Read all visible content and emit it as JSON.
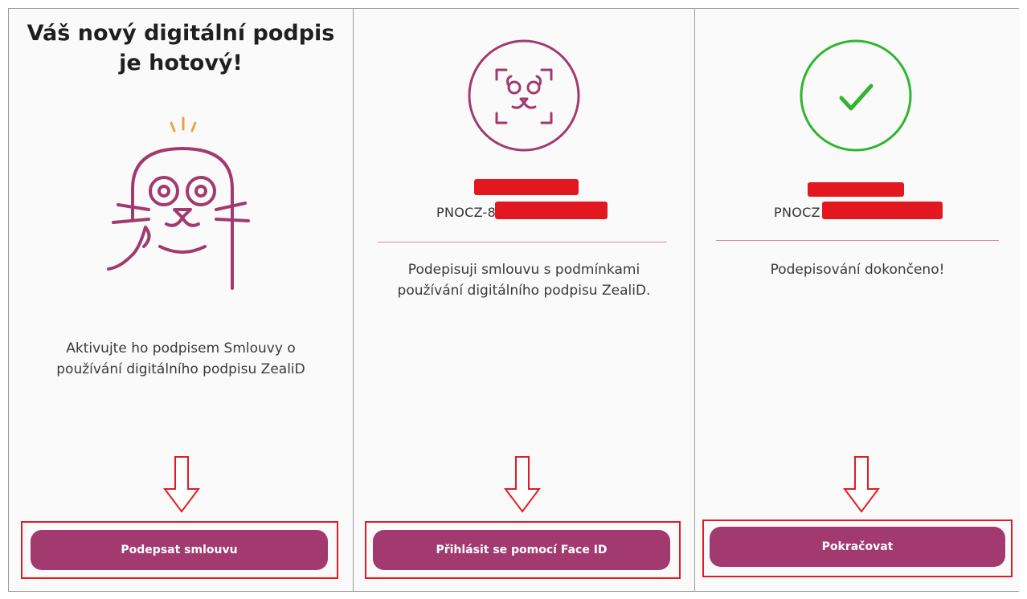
{
  "panel1": {
    "title_line1": "Váš nový digitální podpis",
    "title_line2": "je hotový!",
    "text_line1": "Aktivujte ho podpisem Smlouvy o",
    "text_line2": "používání digitálního podpisu ZealiD",
    "button_label": "Podepsat smlouvu",
    "icon": "seal-mascot-icon"
  },
  "panel2": {
    "id_prefix": "PNOCZ-8",
    "text_line1": "Podepisuji smlouvu s podmínkami",
    "text_line2": "používání digitálního podpisu ZealiD.",
    "button_label": "Přihlásit se pomocí Face ID",
    "icon": "face-id-icon"
  },
  "panel3": {
    "id_prefix": "PNOCZ",
    "text_line1": "Podepisování dokončeno!",
    "button_label": "Pokračovat",
    "icon": "checkmark-circle-icon"
  },
  "colors": {
    "brand": "#a23a70",
    "success": "#2fb52f",
    "annotation_red": "#e21b23",
    "accent_orange": "#f0a040"
  }
}
